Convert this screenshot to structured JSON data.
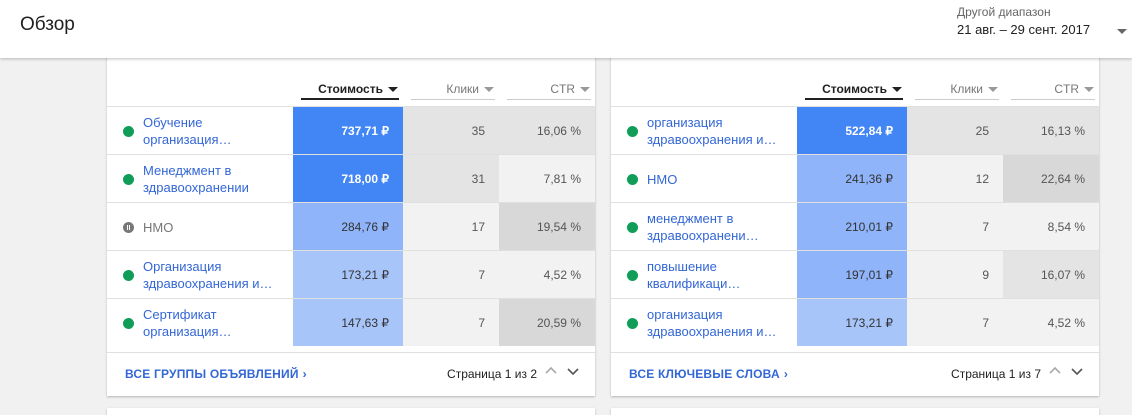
{
  "header": {
    "title": "Обзор",
    "range_label": "Другой диапазон",
    "range_value": "21 авг. – 29 сент. 2017"
  },
  "colors": {
    "cost_dark": "#4285f4",
    "cost_mid": "#8fb4f9",
    "cost_light": "#a8c5fa",
    "grey_dark": "#d8d8d8",
    "grey_mid": "#e4e4e4",
    "grey_light": "#f2f2f2",
    "link": "#3367d6",
    "status_on": "#0f9d58"
  },
  "ad_groups": {
    "columns": {
      "cost": "Стоимость",
      "clicks": "Клики",
      "ctr": "CTR"
    },
    "rows": [
      {
        "name": "Обучение организация…",
        "status": "on",
        "cost": "737,71 ₽",
        "clicks": "35",
        "ctr": "16,06 %",
        "cost_shade": "dark",
        "clicks_shade": "mid",
        "ctr_shade": "mid"
      },
      {
        "name": "Менеджмент в здравоохранении",
        "status": "on",
        "cost": "718,00 ₽",
        "clicks": "31",
        "ctr": "7,81 %",
        "cost_shade": "dark",
        "clicks_shade": "mid",
        "ctr_shade": "light"
      },
      {
        "name": "НМО",
        "status": "paused",
        "cost": "284,76 ₽",
        "clicks": "17",
        "ctr": "19,54 %",
        "cost_shade": "mid",
        "clicks_shade": "light",
        "ctr_shade": "dark"
      },
      {
        "name": "Организация здравоохранения и…",
        "status": "on",
        "cost": "173,21 ₽",
        "clicks": "7",
        "ctr": "4,52 %",
        "cost_shade": "light",
        "clicks_shade": "light",
        "ctr_shade": "light"
      },
      {
        "name": "Сертификат организация…",
        "status": "on",
        "cost": "147,63 ₽",
        "clicks": "7",
        "ctr": "20,59 %",
        "cost_shade": "light",
        "clicks_shade": "light",
        "ctr_shade": "dark"
      }
    ],
    "footer_link": "ВСЕ ГРУППЫ ОБЪЯВЛЕНИЙ",
    "pager": "Страница 1 из 2"
  },
  "keywords": {
    "columns": {
      "cost": "Стоимость",
      "clicks": "Клики",
      "ctr": "CTR"
    },
    "rows": [
      {
        "name": "организация здравоохранения и…",
        "status": "on",
        "cost": "522,84 ₽",
        "clicks": "25",
        "ctr": "16,13 %",
        "cost_shade": "dark",
        "clicks_shade": "mid",
        "ctr_shade": "mid"
      },
      {
        "name": "НМО",
        "status": "on",
        "cost": "241,36 ₽",
        "clicks": "12",
        "ctr": "22,64 %",
        "cost_shade": "mid",
        "clicks_shade": "light",
        "ctr_shade": "dark"
      },
      {
        "name": "менеджмент в здравоохранени…",
        "status": "on",
        "cost": "210,01 ₽",
        "clicks": "7",
        "ctr": "8,54 %",
        "cost_shade": "mid",
        "clicks_shade": "light",
        "ctr_shade": "light"
      },
      {
        "name": "повышение квалификаци…",
        "status": "on",
        "cost": "197,01 ₽",
        "clicks": "9",
        "ctr": "16,07 %",
        "cost_shade": "mid",
        "clicks_shade": "light",
        "ctr_shade": "mid"
      },
      {
        "name": "организация здравоохранения и…",
        "status": "on",
        "cost": "173,21 ₽",
        "clicks": "7",
        "ctr": "4,52 %",
        "cost_shade": "light",
        "clicks_shade": "light",
        "ctr_shade": "light"
      }
    ],
    "footer_link": "ВСЕ КЛЮЧЕВЫЕ СЛОВА",
    "pager": "Страница 1 из 7"
  }
}
